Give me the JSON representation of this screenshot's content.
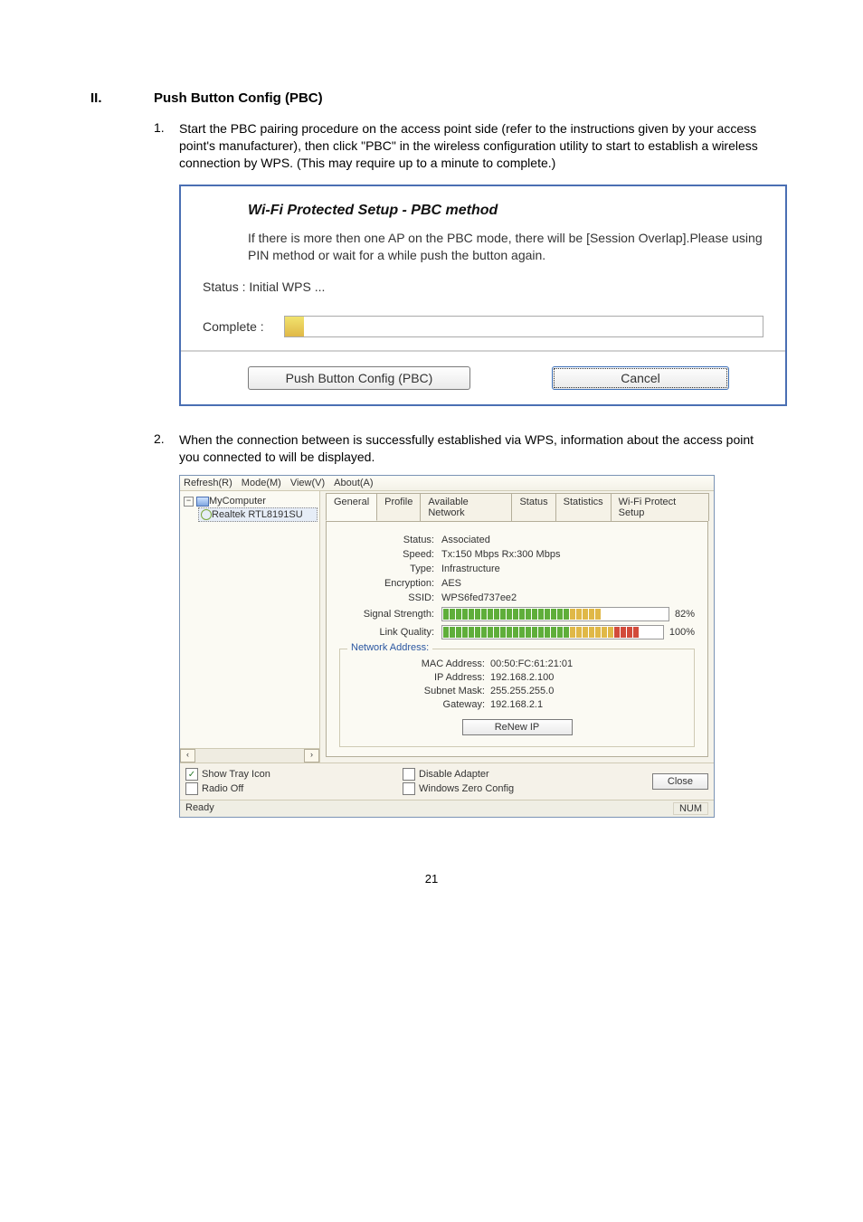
{
  "heading": {
    "num": "II.",
    "text": "Push Button Config (PBC)"
  },
  "step1": {
    "num": "1.",
    "text": "Start the PBC pairing procedure on the access point side (refer to the instructions given by your access point's manufacturer), then click \"PBC\" in the wireless configuration utility to start to establish a wireless connection by WPS. (This may require up to a minute to complete.)"
  },
  "dialog1": {
    "title": "Wi-Fi Protected Setup - PBC method",
    "desc": "If there is more then one AP on the PBC mode, there will be [Session Overlap].Please using PIN method or wait for a while push the button again.",
    "status": "Status : Initial WPS ...",
    "complete_label": "Complete :",
    "btn_pbc": "Push Button Config (PBC)",
    "btn_cancel": "Cancel"
  },
  "step2": {
    "num": "2.",
    "text": "When the connection between is successfully established via WPS, information about the access point you connected to will be displayed."
  },
  "win": {
    "menus": {
      "refresh": "Refresh(R)",
      "mode": "Mode(M)",
      "view": "View(V)",
      "about": "About(A)"
    },
    "tree": {
      "root": "MyComputer",
      "adapter": "Realtek RTL8191SU"
    },
    "tabs": [
      "General",
      "Profile",
      "Available Network",
      "Status",
      "Statistics",
      "Wi-Fi Protect Setup"
    ],
    "general": {
      "status_k": "Status:",
      "status_v": "Associated",
      "speed_k": "Speed:",
      "speed_v": "Tx:150 Mbps Rx:300 Mbps",
      "type_k": "Type:",
      "type_v": "Infrastructure",
      "enc_k": "Encryption:",
      "enc_v": "AES",
      "ssid_k": "SSID:",
      "ssid_v": "WPS6fed737ee2",
      "sig_k": "Signal Strength:",
      "sig_pct": "82%",
      "link_k": "Link Quality:",
      "link_pct": "100%"
    },
    "net": {
      "legend": "Network Address:",
      "mac_k": "MAC Address:",
      "mac_v": "00:50:FC:61:21:01",
      "ip_k": "IP Address:",
      "ip_v": "192.168.2.100",
      "mask_k": "Subnet Mask:",
      "mask_v": "255.255.255.0",
      "gw_k": "Gateway:",
      "gw_v": "192.168.2.1",
      "renew": "ReNew IP"
    },
    "bottom": {
      "show_tray": "Show Tray Icon",
      "radio_off": "Radio Off",
      "disable": "Disable Adapter",
      "wzc": "Windows Zero Config",
      "close": "Close"
    },
    "status_ready": "Ready",
    "status_num": "NUM"
  },
  "page_number": "21"
}
